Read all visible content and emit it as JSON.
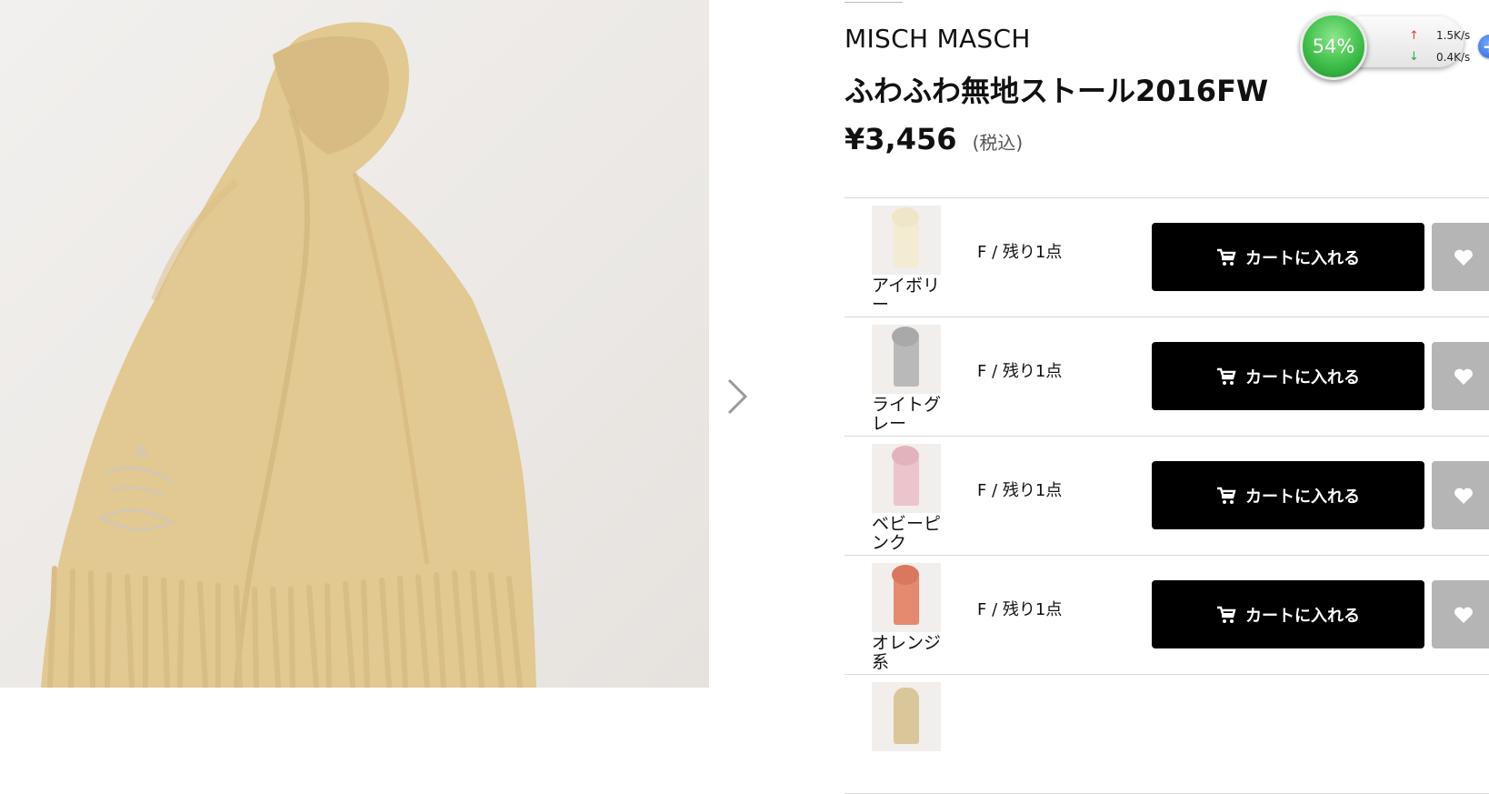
{
  "product": {
    "brand": "MISCH MASCH",
    "title": "ふわふわ無地ストール2016FW",
    "price": "¥3,456",
    "tax_note": "(税込)"
  },
  "variants": [
    {
      "color": "アイボリー",
      "stock": "F / 残り1点",
      "cart_label": "カートに入れる",
      "swatch": "#f4ecd2"
    },
    {
      "color": "ライトグレー",
      "stock": "F / 残り1点",
      "cart_label": "カートに入れる",
      "swatch": "#b9b9b9"
    },
    {
      "color": "ベビーピンク",
      "stock": "F / 残り1点",
      "cart_label": "カートに入れる",
      "swatch": "#ecc4cc"
    },
    {
      "color": "オレンジ系",
      "stock": "F / 残り1点",
      "cart_label": "カートに入れる",
      "swatch": "#e58a6e"
    }
  ],
  "net_widget": {
    "percent": "54%",
    "upload": "1.5K/s",
    "download": "0.4K/s"
  },
  "icons": {
    "next": "chevron-right-icon",
    "cart": "cart-icon",
    "favorite": "heart-icon"
  },
  "colors": {
    "main_scarf": "#e2c891",
    "button_black": "#000000",
    "fav_gray": "#b5b5b5"
  }
}
